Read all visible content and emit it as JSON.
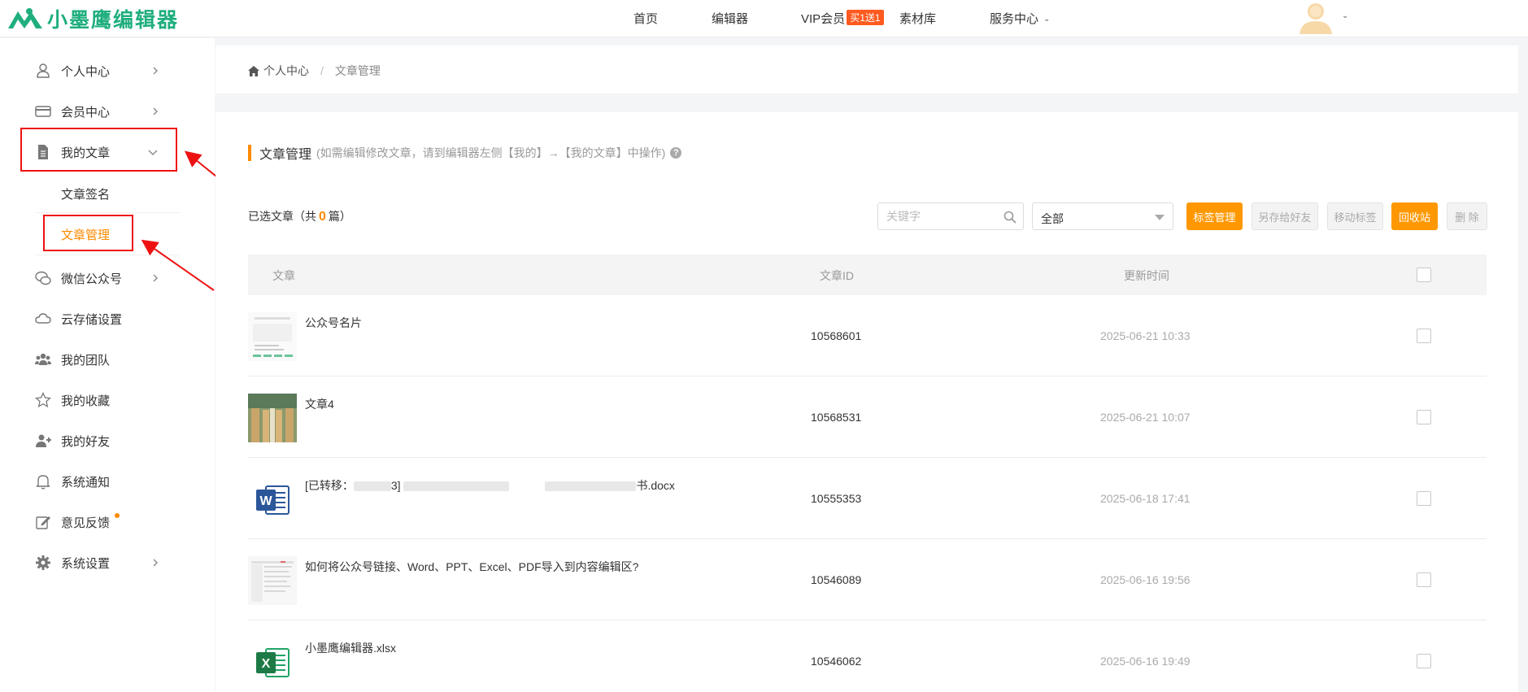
{
  "header": {
    "logo_text": "小墨鹰编辑器",
    "nav": [
      {
        "label": "首页"
      },
      {
        "label": "编辑器"
      },
      {
        "label": "VIP会员",
        "badge": "买1送1"
      },
      {
        "label": "素材库"
      },
      {
        "label": "服务中心"
      }
    ]
  },
  "sidebar": {
    "items": [
      {
        "label": "个人中心",
        "icon": "user-icon"
      },
      {
        "label": "会员中心",
        "icon": "card-icon"
      },
      {
        "label": "我的文章",
        "icon": "document-icon"
      },
      {
        "label": "文章签名"
      },
      {
        "label": "文章管理"
      },
      {
        "label": "微信公众号",
        "icon": "wechat-icon"
      },
      {
        "label": "云存储设置",
        "icon": "cloud-icon"
      },
      {
        "label": "我的团队",
        "icon": "team-icon"
      },
      {
        "label": "我的收藏",
        "icon": "star-icon"
      },
      {
        "label": "我的好友",
        "icon": "add-friend-icon"
      },
      {
        "label": "系统通知",
        "icon": "bell-icon"
      },
      {
        "label": "意见反馈",
        "icon": "edit-icon"
      },
      {
        "label": "系统设置",
        "icon": "gear-icon"
      }
    ]
  },
  "breadcrumb": {
    "home": "个人中心",
    "separator": "/",
    "current": "文章管理"
  },
  "main": {
    "title": "文章管理",
    "hint": "(如需编辑修改文章，请到编辑器左侧【我的】→【我的文章】中操作)",
    "selected_prefix": "已选文章（共",
    "selected_count": "0",
    "selected_suffix": "篇）",
    "search_placeholder": "关键字",
    "filter_value": "全部",
    "buttons": {
      "tag_manage": "标签管理",
      "save_to_friend": "另存给好友",
      "move_tag": "移动标签",
      "recycle": "回收站",
      "delete": "删 除"
    },
    "columns": {
      "article": "文章",
      "id": "文章ID",
      "updated": "更新时间"
    },
    "rows": [
      {
        "title": "公众号名片",
        "id": "10568601",
        "time": "2025-06-21 10:33",
        "thumb": "card-preview"
      },
      {
        "title": "文章4",
        "id": "10568531",
        "time": "2025-06-21 10:07",
        "thumb": "library-photo"
      },
      {
        "title_prefix": "[已转移：",
        "title_mid": "3] ",
        "title_suffix": "书.docx",
        "id": "10555353",
        "time": "2025-06-18 17:41",
        "thumb": "word-icon"
      },
      {
        "title": "如何将公众号链接、Word、PPT、Excel、PDF导入到内容编辑区?",
        "id": "10546089",
        "time": "2025-06-16 19:56",
        "thumb": "doc-preview"
      },
      {
        "title": "小墨鹰编辑器.xlsx",
        "id": "10546062",
        "time": "2025-06-16 19:49",
        "thumb": "excel-icon"
      }
    ]
  },
  "colors": {
    "brand": "#1fae7e",
    "accent": "#ff8a00",
    "annotation": "#e11111"
  }
}
